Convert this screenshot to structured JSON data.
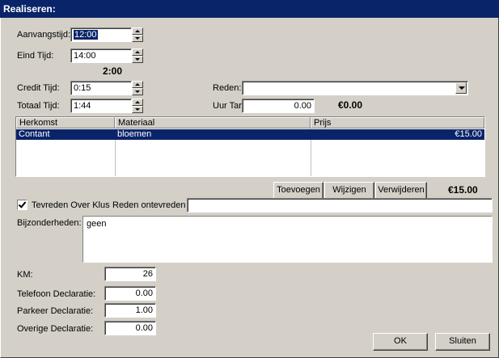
{
  "window": {
    "title": "Realiseren:"
  },
  "labels": {
    "aanvangstijd": "Aanvangstijd:",
    "eind_tijd": "Eind Tijd:",
    "credit_tijd": "Credit Tijd:",
    "totaal_tijd": "Totaal Tijd:",
    "reden": "Reden:",
    "uur_tarief": "Uur Tarief:",
    "tevreden": "Tevreden Over Klus",
    "reden_ontevreden": "Reden ontevreden",
    "bijzonderheden": "Bijzonderheden:",
    "km": "KM:",
    "telefoon": "Telefoon Declaratie:",
    "parkeer": "Parkeer Declaratie:",
    "overige": "Overige Declaratie:"
  },
  "fields": {
    "aanvangstijd": "12:00",
    "eind_tijd": "14:00",
    "duration": "2:00",
    "credit_tijd": "0:15",
    "totaal_tijd": "1:44",
    "reden": "",
    "uur_tarief": "0.00",
    "uur_total": "€0.00",
    "reden_ontevreden": "",
    "bijzonderheden": "geen",
    "km": "26",
    "telefoon": "0.00",
    "parkeer": "1.00",
    "overige": "0.00"
  },
  "table": {
    "columns": [
      "Herkomst",
      "Materiaal",
      "Prijs"
    ],
    "rows": [
      {
        "herkomst": "Contant",
        "materiaal": "bloemen",
        "prijs": "€15.00"
      }
    ],
    "total": "€15.00"
  },
  "buttons": {
    "toevoegen": "Toevoegen",
    "wijzigen": "Wijzigen",
    "verwijderen": "Verwijderen",
    "ok": "OK",
    "sluiten": "Sluiten"
  },
  "tevreden_checked": true
}
